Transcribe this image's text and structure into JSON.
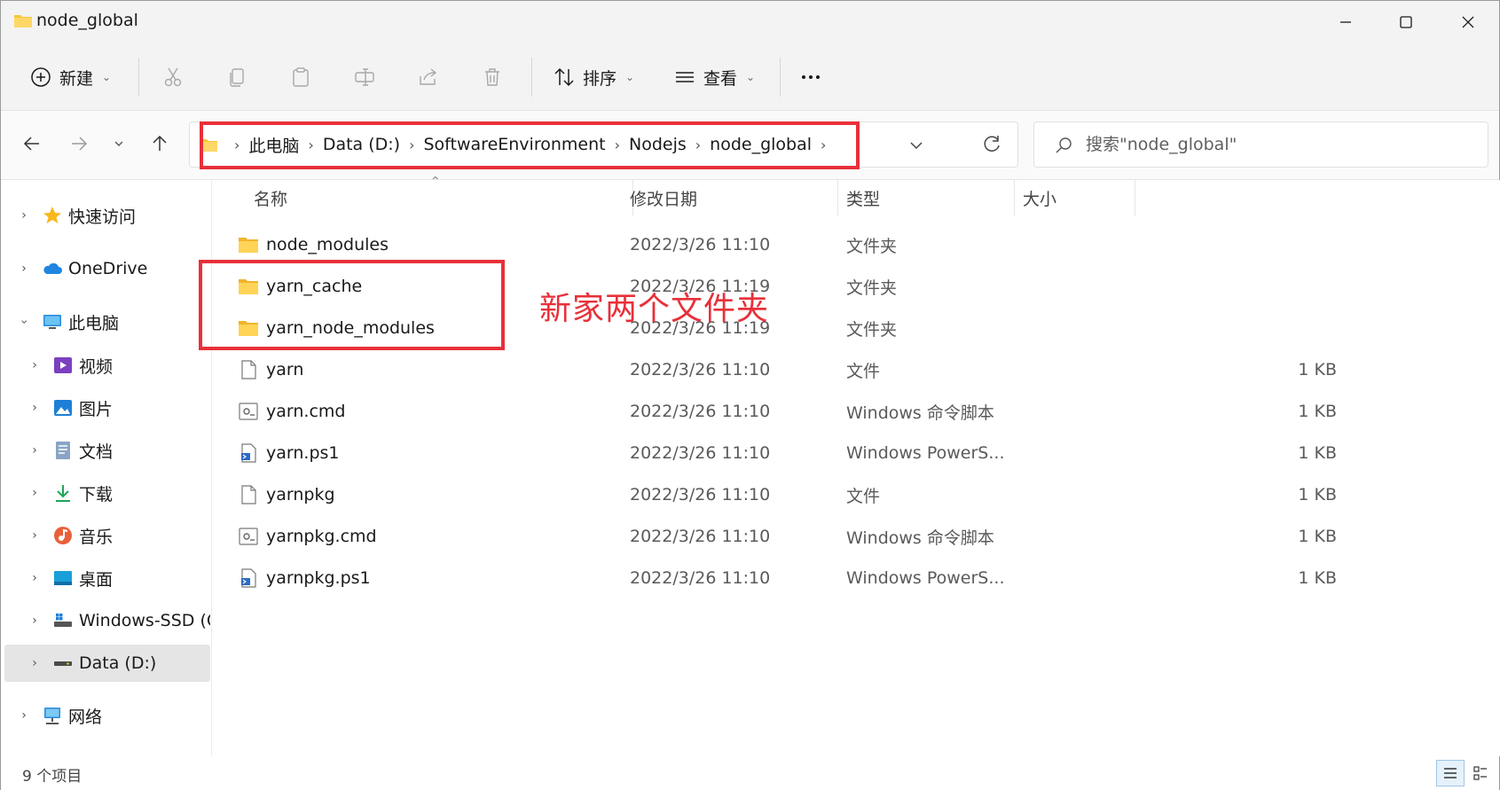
{
  "window": {
    "title": "node_global"
  },
  "toolbar": {
    "new_label": "新建",
    "sort_label": "排序",
    "view_label": "查看"
  },
  "address": {
    "crumbs": [
      "此电脑",
      "Data (D:)",
      "SoftwareEnvironment",
      "Nodejs",
      "node_global"
    ]
  },
  "search": {
    "placeholder": "搜索\"node_global\""
  },
  "sidebar": {
    "items": [
      {
        "label": "快速访问",
        "icon": "star-icon"
      },
      {
        "label": "OneDrive",
        "icon": "cloud-icon"
      },
      {
        "label": "此电脑",
        "icon": "monitor-icon"
      },
      {
        "label": "视频",
        "icon": "video-icon"
      },
      {
        "label": "图片",
        "icon": "pictures-icon"
      },
      {
        "label": "文档",
        "icon": "documents-icon"
      },
      {
        "label": "下载",
        "icon": "download-icon"
      },
      {
        "label": "音乐",
        "icon": "music-icon"
      },
      {
        "label": "桌面",
        "icon": "desktop-icon"
      },
      {
        "label": "Windows-SSD (C",
        "icon": "drive-icon"
      },
      {
        "label": "Data (D:)",
        "icon": "drive-icon"
      },
      {
        "label": "网络",
        "icon": "network-icon"
      }
    ]
  },
  "columns": {
    "name": "名称",
    "date": "修改日期",
    "type": "类型",
    "size": "大小"
  },
  "files": [
    {
      "name": "node_modules",
      "date": "2022/3/26 11:10",
      "type": "文件夹",
      "size": "",
      "icon": "folder-icon"
    },
    {
      "name": "yarn_cache",
      "date": "2022/3/26 11:19",
      "type": "文件夹",
      "size": "",
      "icon": "folder-icon"
    },
    {
      "name": "yarn_node_modules",
      "date": "2022/3/26 11:19",
      "type": "文件夹",
      "size": "",
      "icon": "folder-icon"
    },
    {
      "name": "yarn",
      "date": "2022/3/26 11:10",
      "type": "文件",
      "size": "1 KB",
      "icon": "file-icon"
    },
    {
      "name": "yarn.cmd",
      "date": "2022/3/26 11:10",
      "type": "Windows 命令脚本",
      "size": "1 KB",
      "icon": "cmd-script-icon"
    },
    {
      "name": "yarn.ps1",
      "date": "2022/3/26 11:10",
      "type": "Windows PowerS...",
      "size": "1 KB",
      "icon": "powershell-script-icon"
    },
    {
      "name": "yarnpkg",
      "date": "2022/3/26 11:10",
      "type": "文件",
      "size": "1 KB",
      "icon": "file-icon"
    },
    {
      "name": "yarnpkg.cmd",
      "date": "2022/3/26 11:10",
      "type": "Windows 命令脚本",
      "size": "1 KB",
      "icon": "cmd-script-icon"
    },
    {
      "name": "yarnpkg.ps1",
      "date": "2022/3/26 11:10",
      "type": "Windows PowerS...",
      "size": "1 KB",
      "icon": "powershell-script-icon"
    }
  ],
  "annotation": {
    "text": "新家两个文件夹"
  },
  "status": {
    "item_count": "9 个项目"
  },
  "colors": {
    "accent": "#0067c0",
    "highlight": "#e8303a",
    "folder": "#f8c53a"
  }
}
